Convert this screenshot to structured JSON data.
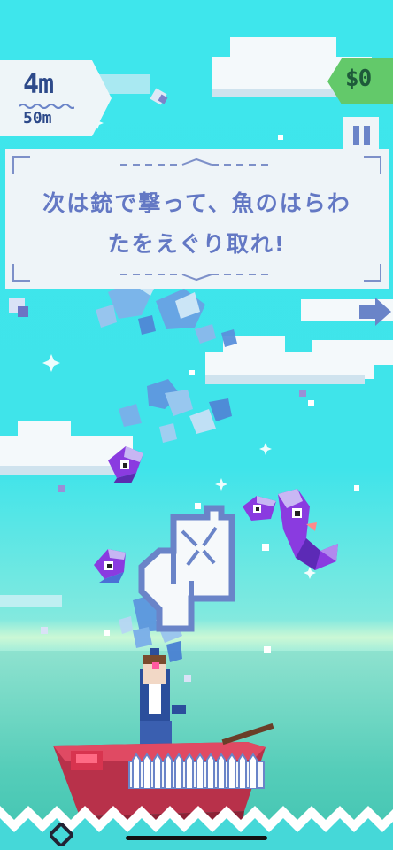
{
  "hud": {
    "depth_current": "4m",
    "depth_max": "50m",
    "money": "$0"
  },
  "tutorial": {
    "line1": "次は銃で撃って、魚のはらわ",
    "line2": "たをえぐり取れ!"
  },
  "icons": {
    "pause": "pause-icon",
    "tap_hint": "tap-gesture-icon",
    "next": "next-arrow-icon",
    "anchor": "anchor-icon"
  },
  "colors": {
    "sky": "#3ee6ec",
    "text_accent": "#6378c4",
    "money_bg": "#63c96a",
    "fish_purple": "#8a3be0",
    "boat_red": "#b8314a"
  }
}
